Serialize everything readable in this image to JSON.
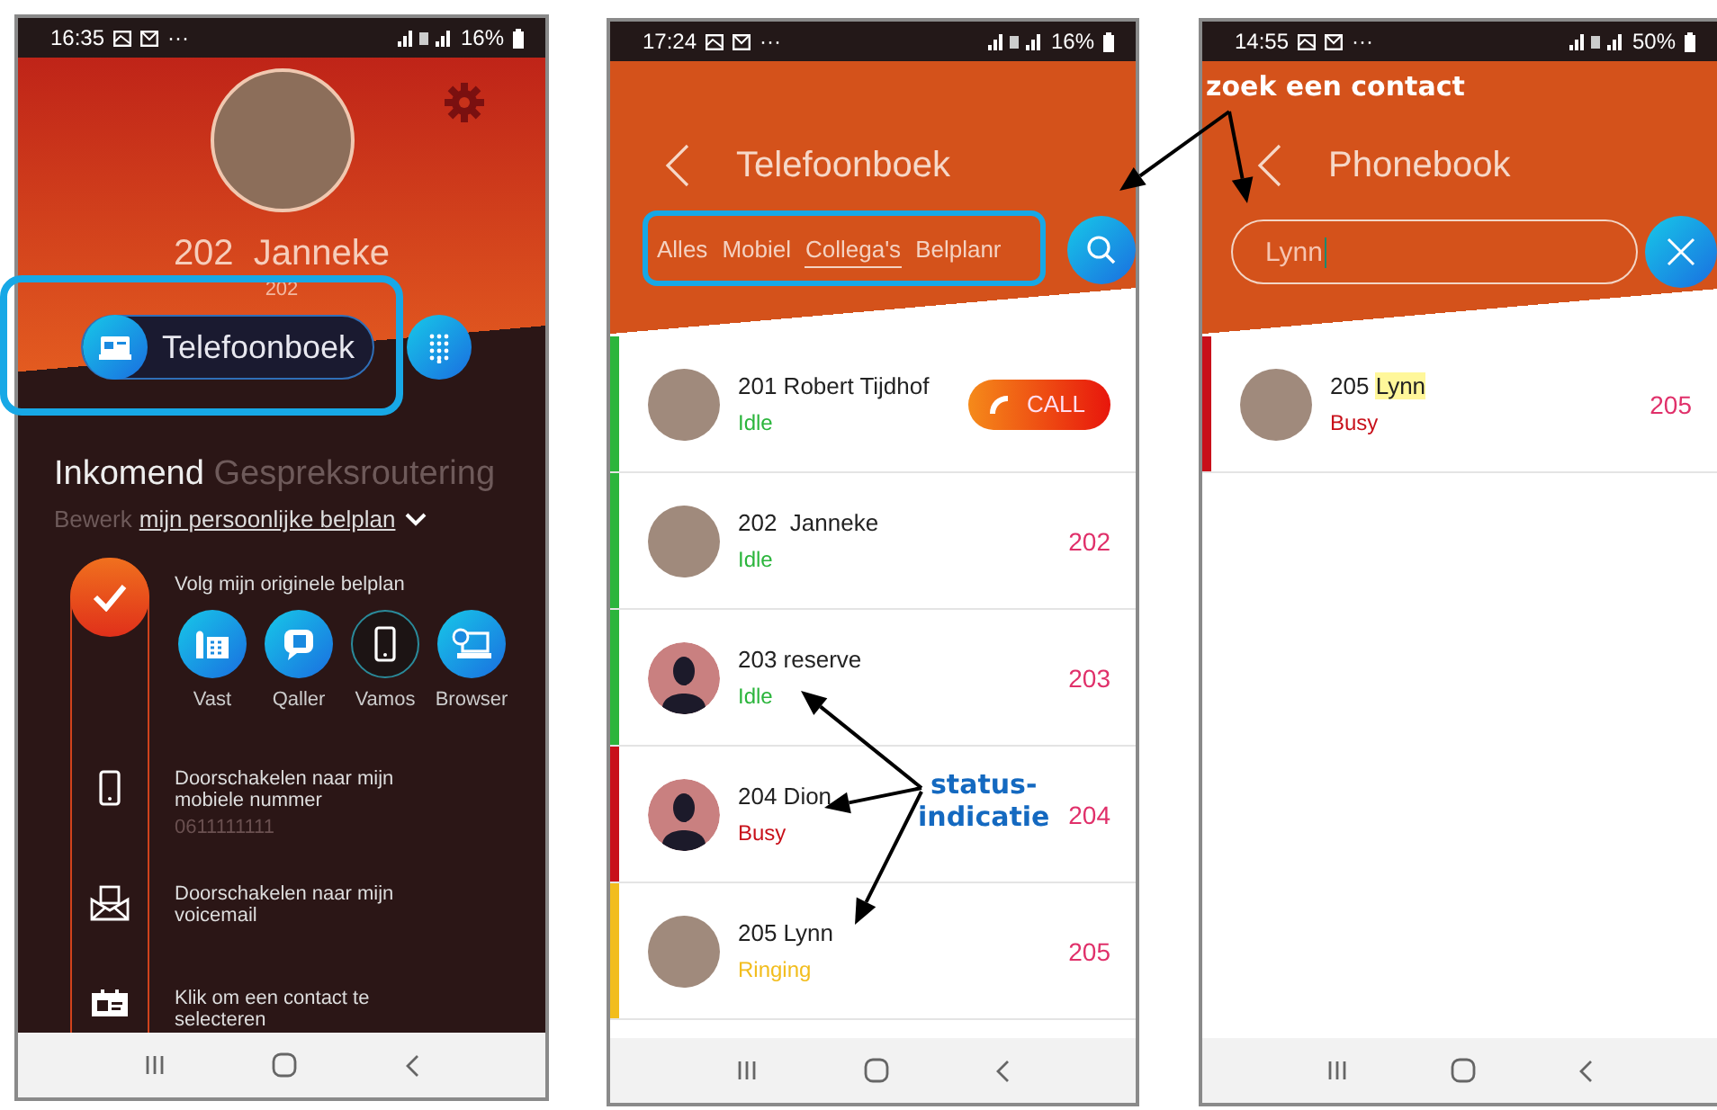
{
  "screen_home": {
    "status_bar": {
      "time": "16:35",
      "dots": "···",
      "battery": "16%"
    },
    "profile": {
      "name": "202  Janneke",
      "extension": "202"
    },
    "phonebook_button": "Telefoonboek",
    "routing": {
      "title": "Inkomend",
      "subtitle": "Gespreksroutering",
      "edit_label": "Bewerk",
      "plan_link": "mijn persoonlijke belplan"
    },
    "options": [
      {
        "kind": "devices",
        "checked": true,
        "label": "Volg mijn originele belplan",
        "devices": [
          {
            "kind": "desk-phone",
            "label": "Vast",
            "enabled": true
          },
          {
            "kind": "chat",
            "label": "Qaller",
            "enabled": true
          },
          {
            "kind": "mobile",
            "label": "Vamos",
            "enabled": false
          },
          {
            "kind": "browser",
            "label": "Browser",
            "enabled": true
          }
        ]
      },
      {
        "kind": "mobile",
        "checked": false,
        "label": "Doorschakelen naar mijn mobiele nummer",
        "detail": "0611111111"
      },
      {
        "kind": "voicemail",
        "checked": false,
        "label": "Doorschakelen naar mijn voicemail"
      },
      {
        "kind": "contact",
        "checked": false,
        "label": "Klik om een contact te selecteren"
      }
    ]
  },
  "screen_phonebook": {
    "status_bar": {
      "time": "17:24",
      "dots": "···",
      "battery": "16%"
    },
    "title": "Telefoonboek",
    "tabs": [
      {
        "label": "Alles",
        "selected": false
      },
      {
        "label": "Mobiel",
        "selected": false
      },
      {
        "label": "Collega's",
        "selected": true
      },
      {
        "label": "Belplanr",
        "selected": false
      }
    ],
    "contacts": [
      {
        "name": "201 Robert Tijdhof",
        "status": "Idle",
        "color": "#2bb53c",
        "kind": "photo",
        "call_button": "CALL"
      },
      {
        "name": "202  Janneke",
        "status": "Idle",
        "color": "#2bb53c",
        "kind": "photo",
        "number": "202"
      },
      {
        "name": "203 reserve",
        "status": "Idle",
        "color": "#2bb53c",
        "kind": "silhouette",
        "number": "203"
      },
      {
        "name": "204 Dion",
        "status": "Busy",
        "color": "#c8101a",
        "kind": "silhouette",
        "number": "204"
      },
      {
        "name": "205 Lynn",
        "status": "Ringing",
        "color": "#f2bd1d",
        "kind": "photo",
        "number": "205"
      }
    ]
  },
  "screen_search": {
    "status_bar": {
      "time": "14:55",
      "dots": "···",
      "battery": "50%"
    },
    "title": "Phonebook",
    "search": {
      "value": "Lynn"
    },
    "results": [
      {
        "prefix": "205",
        "match": "Lynn",
        "status": "Busy",
        "color": "#c8101a",
        "number": "205"
      }
    ]
  },
  "annotations": [
    {
      "text": "zoek een contact"
    },
    {
      "text": "status-indicatie"
    }
  ]
}
